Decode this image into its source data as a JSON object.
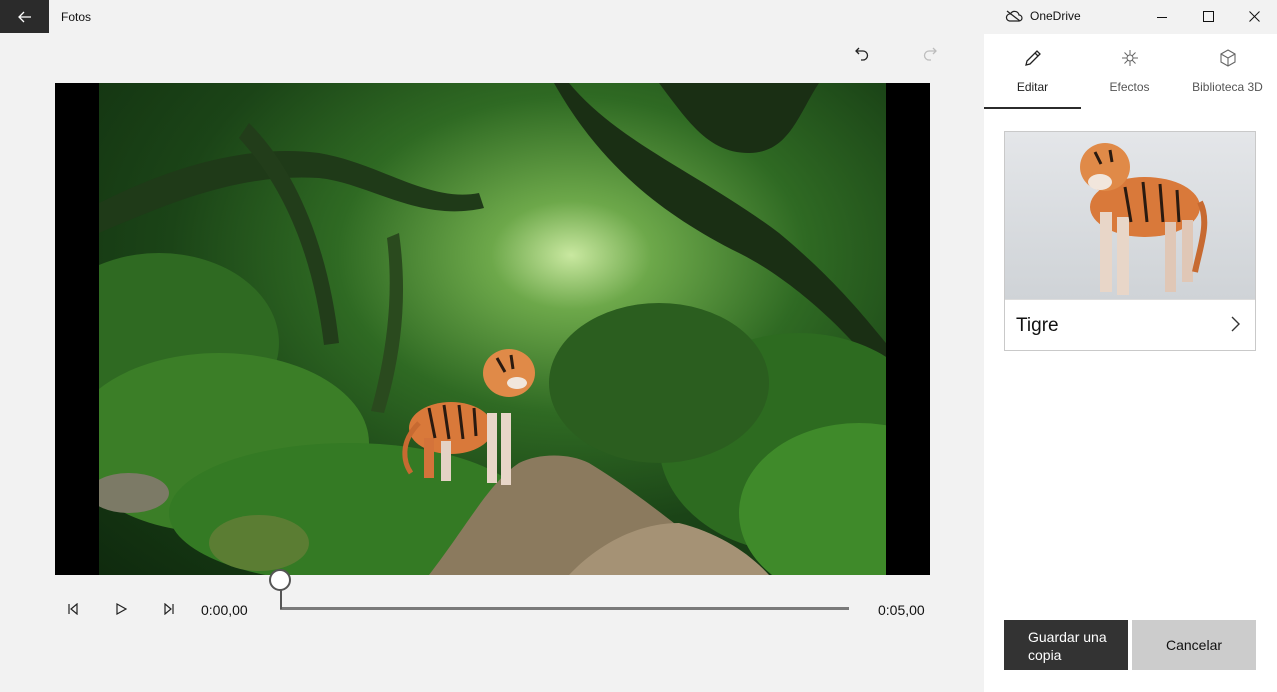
{
  "window": {
    "title": "Fotos",
    "onedrive_label": "OneDrive",
    "controls": [
      "minimize",
      "maximize",
      "close"
    ]
  },
  "toolbar": {
    "undo_icon": "undo-icon",
    "redo_icon": "redo-icon",
    "redo_enabled": false
  },
  "playback": {
    "current_time": "0:00,00",
    "total_time": "0:05,00",
    "progress": 0
  },
  "panel": {
    "tabs": [
      {
        "label": "Editar",
        "icon": "pencil-icon",
        "selected": true
      },
      {
        "label": "Efectos",
        "icon": "sparkle-icon",
        "selected": false
      },
      {
        "label": "Biblioteca 3D",
        "icon": "cube-icon",
        "selected": false
      }
    ],
    "model_card": {
      "name": "Tigre"
    },
    "buttons": {
      "save": "Guardar una copia",
      "cancel": "Cancelar"
    }
  },
  "colors": {
    "titlebar_back": "#2b2b2b",
    "save_button": "#333333",
    "cancel_button": "#cccccc",
    "tiger_orange": "#d9793a"
  }
}
